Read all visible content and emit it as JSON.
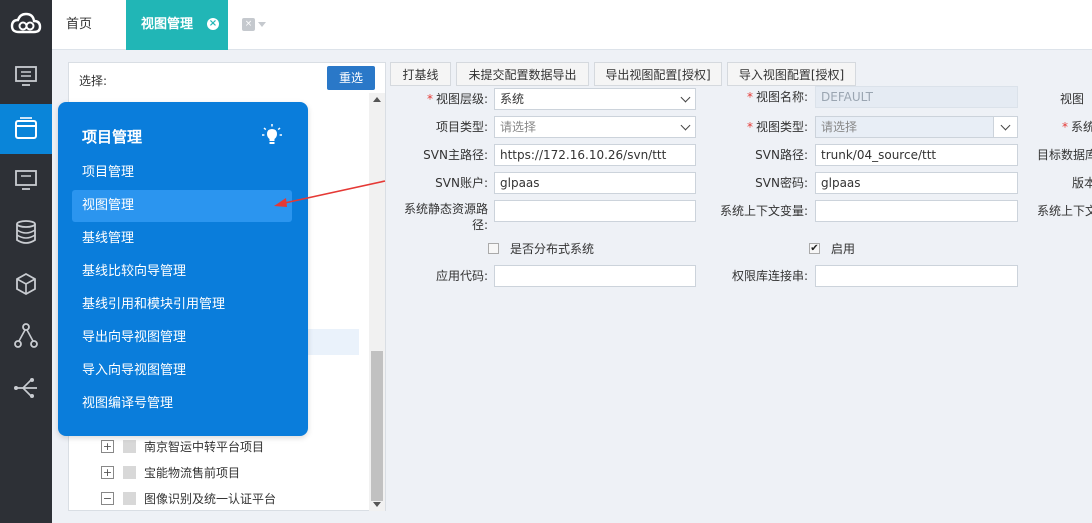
{
  "tabs": {
    "home": "首页",
    "active": "视图管理",
    "close_glyph": "×"
  },
  "tree_panel": {
    "select_label": "选择:",
    "reset_button": "重选",
    "rows": [
      {
        "label": "南京智运中转平台项目",
        "expander": "+"
      },
      {
        "label": "宝能物流售前项目",
        "expander": "+"
      },
      {
        "label": "图像识别及统一认证平台",
        "expander": "−"
      }
    ]
  },
  "menu": {
    "title": "项目管理",
    "items": [
      "项目管理",
      "视图管理",
      "基线管理",
      "基线比较向导管理",
      "基线引用和模块引用管理",
      "导出向导视图管理",
      "导入向导视图管理",
      "视图编译号管理"
    ],
    "selected_index": 1
  },
  "toolbar": {
    "buttons": [
      "打基线",
      "未提交配置数据导出",
      "导出视图配置[授权]",
      "导入视图配置[授权]"
    ]
  },
  "form": {
    "view_level_label": "视图层级:",
    "view_level_value": "系统",
    "view_name_label": "视图名称:",
    "view_name_value": "DEFAULT",
    "col3_row1_label": "视图",
    "project_type_label": "项目类型:",
    "project_type_placeholder": "请选择",
    "view_type_label": "视图类型:",
    "view_type_placeholder": "请选择",
    "col3_row2_label": "系统",
    "svn_main_path_label": "SVN主路径:",
    "svn_main_path_value": "https://172.16.10.26/svn/ttt",
    "svn_path_label": "SVN路径:",
    "svn_path_value": "trunk/04_source/ttt",
    "col3_row3_label": "目标数据库",
    "svn_account_label": "SVN账户:",
    "svn_account_value": "glpaas",
    "svn_password_label": "SVN密码:",
    "svn_password_value": "glpaas",
    "col3_row4_label": "版本",
    "static_path_label_1": "系统静态资源路",
    "static_path_label_2": "径:",
    "sys_context_label": "系统上下文变量:",
    "col3_row5_label": "系统上下文",
    "distributed_label": "是否分布式系统",
    "distributed_checked": false,
    "enabled_label": "启用",
    "enabled_checked": true,
    "check_glyph": "✔",
    "app_code_label": "应用代码:",
    "perm_db_label": "权限库连接串:",
    "required_mark": "*"
  },
  "icons": {
    "sidebar": [
      "cloud-logo-icon",
      "monitor-icon",
      "window-icon",
      "monitor-icon",
      "database-icon",
      "cube-icon",
      "branch-icon",
      "share-icon"
    ],
    "menu_title_icon": "lightbulb-icon"
  },
  "colors": {
    "sidebar_bg": "#2d3036",
    "sidebar_active": "#0a85d9",
    "tab_active": "#21b6b6",
    "menu_bg": "#0a7ddb",
    "menu_selected": "#2b95ef",
    "reset_button": "#2a78c8",
    "required": "#e53935",
    "arrow": "#e53935"
  }
}
